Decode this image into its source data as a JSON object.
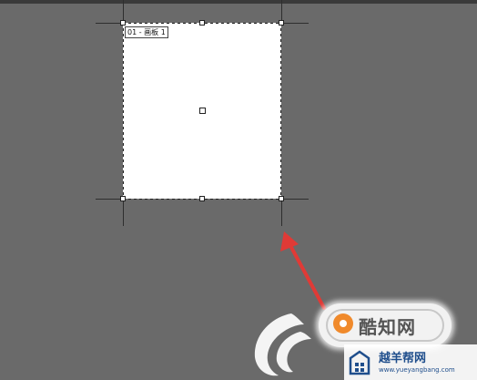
{
  "artboard": {
    "label": "01 - 画板 1"
  },
  "watermark": {
    "badge_text": "酷知网",
    "site_name": "越羊帮网",
    "site_url": "www.yueyangbang.com"
  },
  "colors": {
    "canvas_bg": "#6a6a6a",
    "artboard_bg": "#ffffff",
    "arrow": "#e03a36",
    "logo_orange": "#f08a2c"
  },
  "icons": [
    "artboard-center-handle",
    "red-arrow",
    "swirl-logo",
    "kuzhi-logo",
    "yueyang-logo"
  ]
}
